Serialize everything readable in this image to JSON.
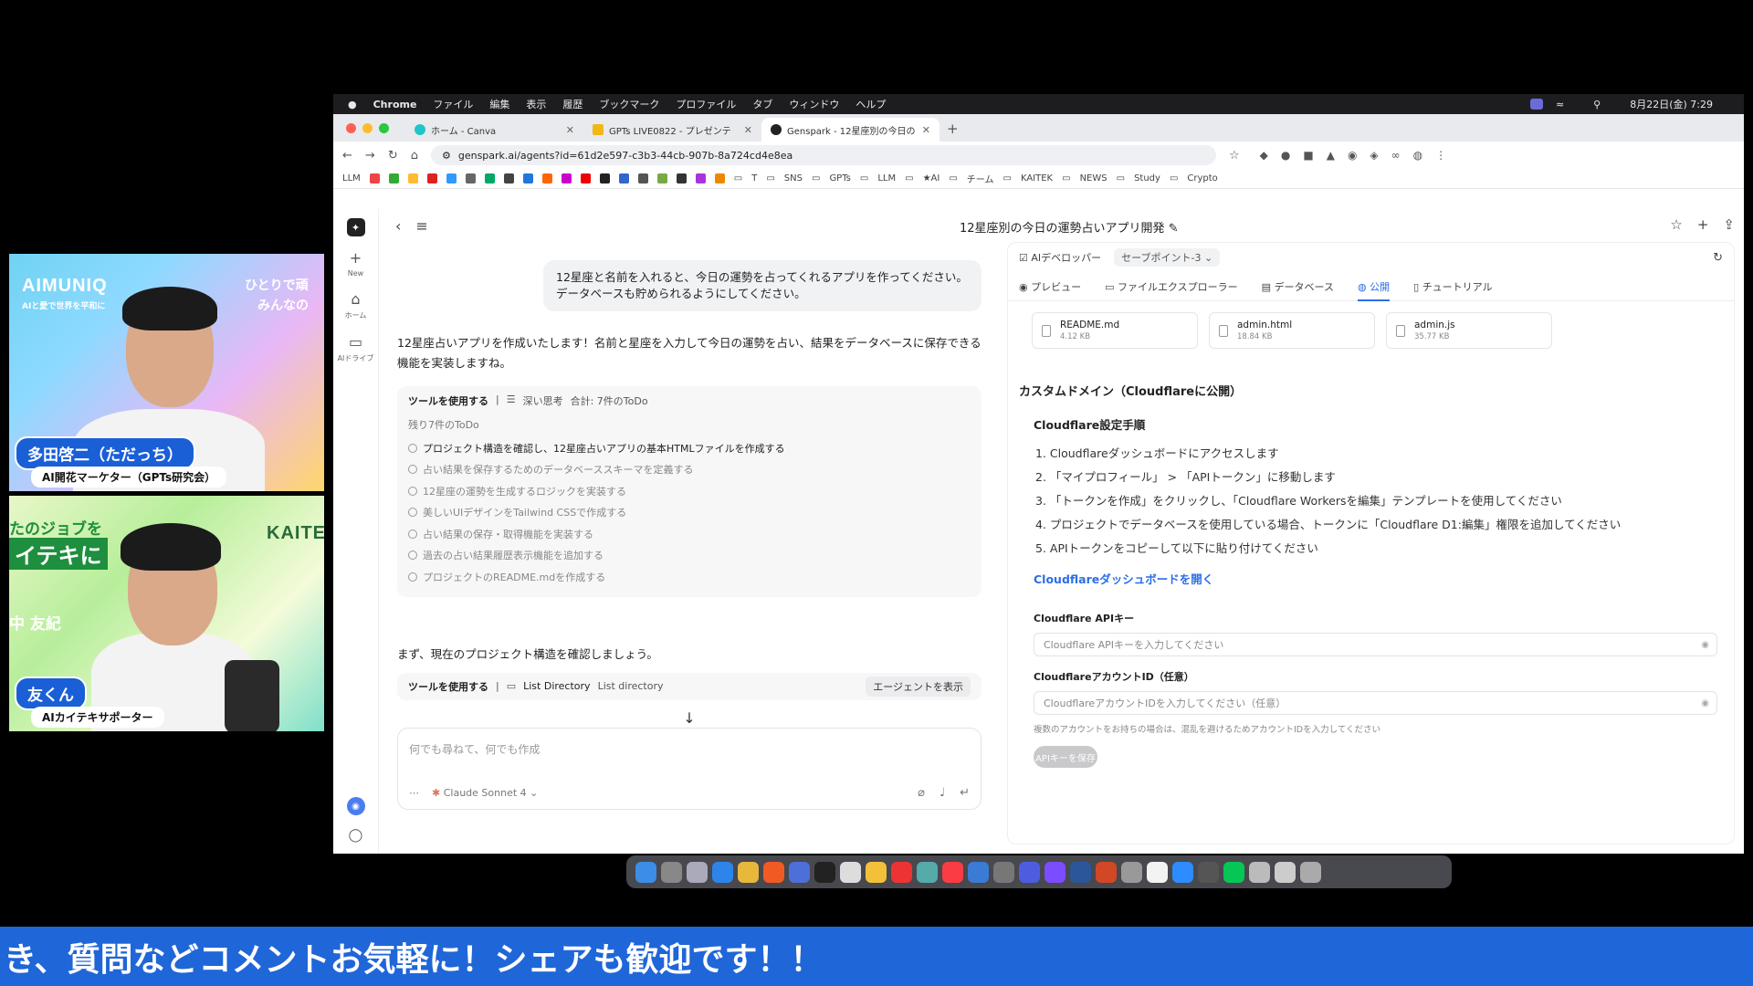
{
  "webcam1": {
    "brand": "AIMUNIQ",
    "brand_sub": "AIと愛で世界を平和に",
    "banner_right_1": "ひとりで頑",
    "banner_right_2": "みんなの",
    "name": "多田啓二（ただっち）",
    "role": "AI開花マーケター（GPTs研究会）"
  },
  "webcam2": {
    "banner_left_1": "たのジョブを",
    "banner_left_2": "イテキに",
    "banner_left_3": "中 友紀",
    "brand_right": "KAITE",
    "name": "友くん",
    "role": "AIカイテキサポーター"
  },
  "menubar": {
    "app": "Chrome",
    "items": [
      "ファイル",
      "編集",
      "表示",
      "履歴",
      "ブックマーク",
      "プロファイル",
      "タブ",
      "ウィンドウ",
      "ヘルプ"
    ],
    "clock": "8月22日(金) 7:29"
  },
  "tabs": [
    {
      "title": "ホーム - Canva"
    },
    {
      "title": "GPTs LIVE0822 - プレゼンテ"
    },
    {
      "title": "Genspark - 12星座別の今日の"
    }
  ],
  "address": {
    "url": "genspark.ai/agents?id=61d2e597-c3b3-44cb-907b-8a724cd4e8ea"
  },
  "bookmarks": [
    "LLM",
    "T",
    "SNS",
    "GPTs",
    "LLM",
    "★AI",
    "チーム",
    "KAITEK",
    "NEWS",
    "Study",
    "Crypto"
  ],
  "rail": {
    "new_label": "New",
    "home_label": "ホーム",
    "drive_label": "AIドライブ"
  },
  "chat": {
    "user_message": "12星座と名前を入れると、今日の運勢を占ってくれるアプリを作ってください。データベースも貯められるようにしてください。",
    "reply": "12星座占いアプリを作成いたします！名前と星座を入力して今日の運勢を占い、結果をデータベースに保存できる機能を実装しますね。",
    "tool_header": "ツールを使用する",
    "tool_deep": "深い思考",
    "tool_total": "合計: 7件のToDo",
    "todo_title": "残り7件のToDo",
    "todos": [
      "プロジェクト構造を確認し、12星座占いアプリの基本HTMLファイルを作成する",
      "占い結果を保存するためのデータベーススキーマを定義する",
      "12星座の運勢を生成するロジックを実装する",
      "美しいUIデザインをTailwind CSSで作成する",
      "占い結果の保存・取得機能を実装する",
      "過去の占い結果履歴表示機能を追加する",
      "プロジェクトのREADME.mdを作成する"
    ],
    "check_message": "まず、現在のプロジェクト構造を確認しましょう。",
    "tool2_header": "ツールを使用する",
    "tool2_name": "List Directory",
    "tool2_desc": "List directory",
    "agent_button": "エージェントを表示",
    "input_placeholder": "何でも尋ねて、何でも作成",
    "model": "Claude Sonnet 4"
  },
  "panel": {
    "title": "12星座別の今日の運勢占いアプリ開発",
    "developer": "AIデベロッパー",
    "savepoint": "セーブポイント-3",
    "tabs": [
      "プレビュー",
      "ファイルエクスプローラー",
      "データベース",
      "公開",
      "チュートリアル"
    ],
    "files": [
      {
        "name": "README.md",
        "size": "4.12 KB"
      },
      {
        "name": "admin.html",
        "size": "18.84 KB"
      },
      {
        "name": "admin.js",
        "size": "35.77 KB"
      }
    ],
    "section_title": "カスタムドメイン（Cloudflareに公開）",
    "setup_title": "Cloudflare設定手順",
    "steps": [
      "1. Cloudflareダッシュボードにアクセスします",
      "2. 「マイプロフィール」 > 「APIトークン」に移動します",
      "3. 「トークンを作成」をクリックし、「Cloudflare Workersを編集」テンプレートを使用してください",
      "4. プロジェクトでデータベースを使用している場合、トークンに「Cloudflare D1:編集」権限を追加してください",
      "5. APIトークンをコピーして以下に貼り付けてください"
    ],
    "dashboard_link": "Cloudflareダッシュボードを開く",
    "api_key_label": "Cloudflare APIキー",
    "api_key_placeholder": "Cloudflare APIキーを入力してください",
    "account_label": "CloudflareアカウントID（任意）",
    "account_placeholder": "CloudflareアカウントIDを入力してください（任意）",
    "hint": "複数のアカウントをお持ちの場合は、混乱を避けるためアカウントIDを入力してください",
    "save_button": "APIキーを保存"
  },
  "ticker": "き、質問などコメントお気軽に！シェアも歓迎です！！"
}
